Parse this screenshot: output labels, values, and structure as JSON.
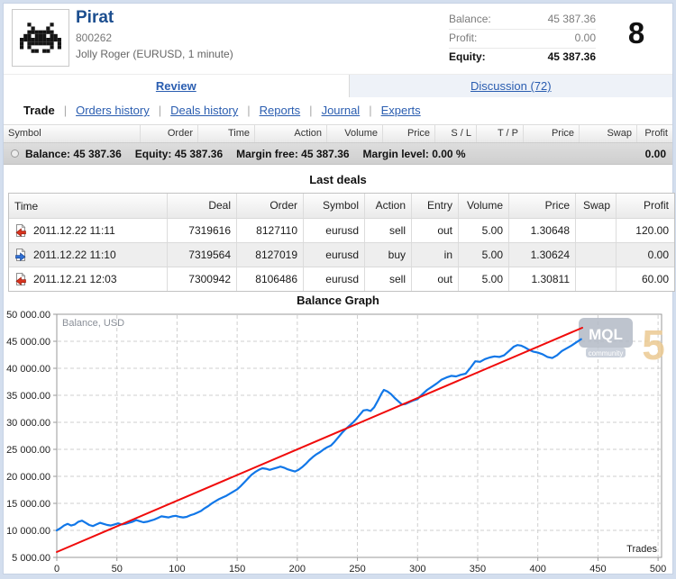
{
  "header": {
    "title": "Pirat",
    "account": "800262",
    "subtitle": "Jolly Roger (EURUSD, 1 minute)",
    "stats": [
      {
        "label": "Balance:",
        "value": "45 387.36",
        "emphasis": false
      },
      {
        "label": "Profit:",
        "value": "0.00",
        "emphasis": false
      },
      {
        "label": "Equity:",
        "value": "45 387.36",
        "emphasis": true
      }
    ],
    "rating": "8"
  },
  "tabs": [
    {
      "label": "Review",
      "active": true
    },
    {
      "label": "Discussion (72)",
      "active": false
    }
  ],
  "subnav": {
    "current": "Trade",
    "separator": "|",
    "links": [
      "Orders history",
      "Deals history",
      "Reports",
      "Journal",
      "Experts"
    ]
  },
  "positions_table": {
    "columns": [
      "Symbol",
      "Order",
      "Time",
      "Action",
      "Volume",
      "Price",
      "S / L",
      "T / P",
      "Price",
      "Swap",
      "Profit"
    ],
    "summary": {
      "items": [
        "Balance: 45 387.36",
        "Equity: 45 387.36",
        "Margin free: 45 387.36",
        "Margin level: 0.00 %"
      ],
      "profit": "0.00"
    }
  },
  "last_deals": {
    "title": "Last deals",
    "columns": [
      "Time",
      "Deal",
      "Order",
      "Symbol",
      "Action",
      "Entry",
      "Volume",
      "Price",
      "Swap",
      "Profit"
    ],
    "rows": [
      {
        "icon": "deal-out-icon",
        "time": "2011.12.22 11:11",
        "deal": "7319616",
        "order": "8127110",
        "symbol": "eurusd",
        "action": "sell",
        "entry": "out",
        "volume": "5.00",
        "price": "1.30648",
        "swap": "",
        "profit": "120.00"
      },
      {
        "icon": "deal-in-icon",
        "time": "2011.12.22 11:10",
        "deal": "7319564",
        "order": "8127019",
        "symbol": "eurusd",
        "action": "buy",
        "entry": "in",
        "volume": "5.00",
        "price": "1.30624",
        "swap": "",
        "profit": "0.00"
      },
      {
        "icon": "deal-out-icon",
        "time": "2011.12.21 12:03",
        "deal": "7300942",
        "order": "8106486",
        "symbol": "eurusd",
        "action": "sell",
        "entry": "out",
        "volume": "5.00",
        "price": "1.30811",
        "swap": "",
        "profit": "60.00"
      }
    ]
  },
  "chart_data": {
    "type": "line",
    "title": "Balance Graph",
    "inner_label": "Balance, USD",
    "xlabel": "Trades",
    "xlim": [
      0,
      500
    ],
    "ylim": [
      5000,
      50000
    ],
    "x_ticks": [
      0,
      50,
      100,
      150,
      200,
      250,
      300,
      350,
      400,
      450,
      500
    ],
    "y_tick_labels": [
      "50 000.00",
      "45 000.00",
      "40 000.00",
      "35 000.00",
      "30 000.00",
      "25 000.00",
      "20 000.00",
      "15 000.00",
      "10 000.00",
      "5 000.00"
    ],
    "grid": true,
    "series": [
      {
        "name": "Balance",
        "color": "#1177e8",
        "width": 2.2,
        "points": [
          [
            0,
            10000
          ],
          [
            3,
            10400
          ],
          [
            6,
            10900
          ],
          [
            9,
            11200
          ],
          [
            12,
            10900
          ],
          [
            15,
            11100
          ],
          [
            18,
            11600
          ],
          [
            21,
            11800
          ],
          [
            24,
            11400
          ],
          [
            27,
            11000
          ],
          [
            30,
            10800
          ],
          [
            33,
            11100
          ],
          [
            36,
            11400
          ],
          [
            39,
            11200
          ],
          [
            42,
            11000
          ],
          [
            45,
            10900
          ],
          [
            48,
            11100
          ],
          [
            51,
            11300
          ],
          [
            54,
            11100
          ],
          [
            57,
            11200
          ],
          [
            60,
            11400
          ],
          [
            63,
            11600
          ],
          [
            66,
            11900
          ],
          [
            69,
            11700
          ],
          [
            72,
            11500
          ],
          [
            75,
            11600
          ],
          [
            78,
            11800
          ],
          [
            81,
            12000
          ],
          [
            84,
            12300
          ],
          [
            87,
            12600
          ],
          [
            90,
            12500
          ],
          [
            93,
            12400
          ],
          [
            96,
            12600
          ],
          [
            99,
            12700
          ],
          [
            102,
            12500
          ],
          [
            105,
            12400
          ],
          [
            108,
            12500
          ],
          [
            111,
            12800
          ],
          [
            114,
            13000
          ],
          [
            117,
            13300
          ],
          [
            120,
            13600
          ],
          [
            123,
            14100
          ],
          [
            126,
            14500
          ],
          [
            129,
            15000
          ],
          [
            132,
            15400
          ],
          [
            135,
            15800
          ],
          [
            138,
            16100
          ],
          [
            141,
            16400
          ],
          [
            144,
            16800
          ],
          [
            147,
            17200
          ],
          [
            150,
            17600
          ],
          [
            153,
            18200
          ],
          [
            156,
            18900
          ],
          [
            159,
            19600
          ],
          [
            162,
            20300
          ],
          [
            165,
            20800
          ],
          [
            168,
            21200
          ],
          [
            171,
            21500
          ],
          [
            174,
            21400
          ],
          [
            177,
            21200
          ],
          [
            180,
            21400
          ],
          [
            183,
            21600
          ],
          [
            186,
            21800
          ],
          [
            189,
            21600
          ],
          [
            192,
            21300
          ],
          [
            195,
            21100
          ],
          [
            198,
            20900
          ],
          [
            201,
            21200
          ],
          [
            204,
            21700
          ],
          [
            207,
            22300
          ],
          [
            210,
            23000
          ],
          [
            213,
            23600
          ],
          [
            216,
            24100
          ],
          [
            219,
            24500
          ],
          [
            222,
            25000
          ],
          [
            225,
            25400
          ],
          [
            228,
            25700
          ],
          [
            231,
            26400
          ],
          [
            234,
            27200
          ],
          [
            237,
            28000
          ],
          [
            240,
            28700
          ],
          [
            243,
            29300
          ],
          [
            246,
            29900
          ],
          [
            249,
            30600
          ],
          [
            252,
            31400
          ],
          [
            255,
            32200
          ],
          [
            258,
            32300
          ],
          [
            261,
            32100
          ],
          [
            264,
            32800
          ],
          [
            267,
            34000
          ],
          [
            270,
            35300
          ],
          [
            272,
            36000
          ],
          [
            275,
            35700
          ],
          [
            278,
            35200
          ],
          [
            281,
            34500
          ],
          [
            284,
            33900
          ],
          [
            287,
            33300
          ],
          [
            290,
            33400
          ],
          [
            293,
            33700
          ],
          [
            296,
            34000
          ],
          [
            300,
            34300
          ],
          [
            304,
            35200
          ],
          [
            308,
            36000
          ],
          [
            312,
            36600
          ],
          [
            316,
            37200
          ],
          [
            320,
            37900
          ],
          [
            324,
            38300
          ],
          [
            328,
            38600
          ],
          [
            332,
            38500
          ],
          [
            336,
            38800
          ],
          [
            340,
            39000
          ],
          [
            344,
            40100
          ],
          [
            348,
            41300
          ],
          [
            352,
            41200
          ],
          [
            356,
            41700
          ],
          [
            360,
            42000
          ],
          [
            364,
            42200
          ],
          [
            368,
            42100
          ],
          [
            372,
            42400
          ],
          [
            376,
            43200
          ],
          [
            380,
            44000
          ],
          [
            383,
            44300
          ],
          [
            386,
            44200
          ],
          [
            389,
            43900
          ],
          [
            392,
            43500
          ],
          [
            396,
            43100
          ],
          [
            400,
            42900
          ],
          [
            404,
            42600
          ],
          [
            408,
            42100
          ],
          [
            412,
            41900
          ],
          [
            416,
            42400
          ],
          [
            420,
            43200
          ],
          [
            424,
            43700
          ],
          [
            428,
            44200
          ],
          [
            432,
            44800
          ],
          [
            436,
            45387
          ]
        ]
      },
      {
        "name": "Trend",
        "color": "#f00b0b",
        "width": 2,
        "points": [
          [
            0,
            6000
          ],
          [
            437,
            47500
          ]
        ]
      }
    ],
    "watermark": {
      "line1": "MQL",
      "line2": "community",
      "digit": "5"
    }
  },
  "colors": {
    "frame": "#d3deee",
    "link": "#2a5db0",
    "title_blue": "#1c4e8f",
    "balance_line": "#1177e8",
    "trend_line": "#f00b0b",
    "summary_bg": "#d4d4d4"
  }
}
